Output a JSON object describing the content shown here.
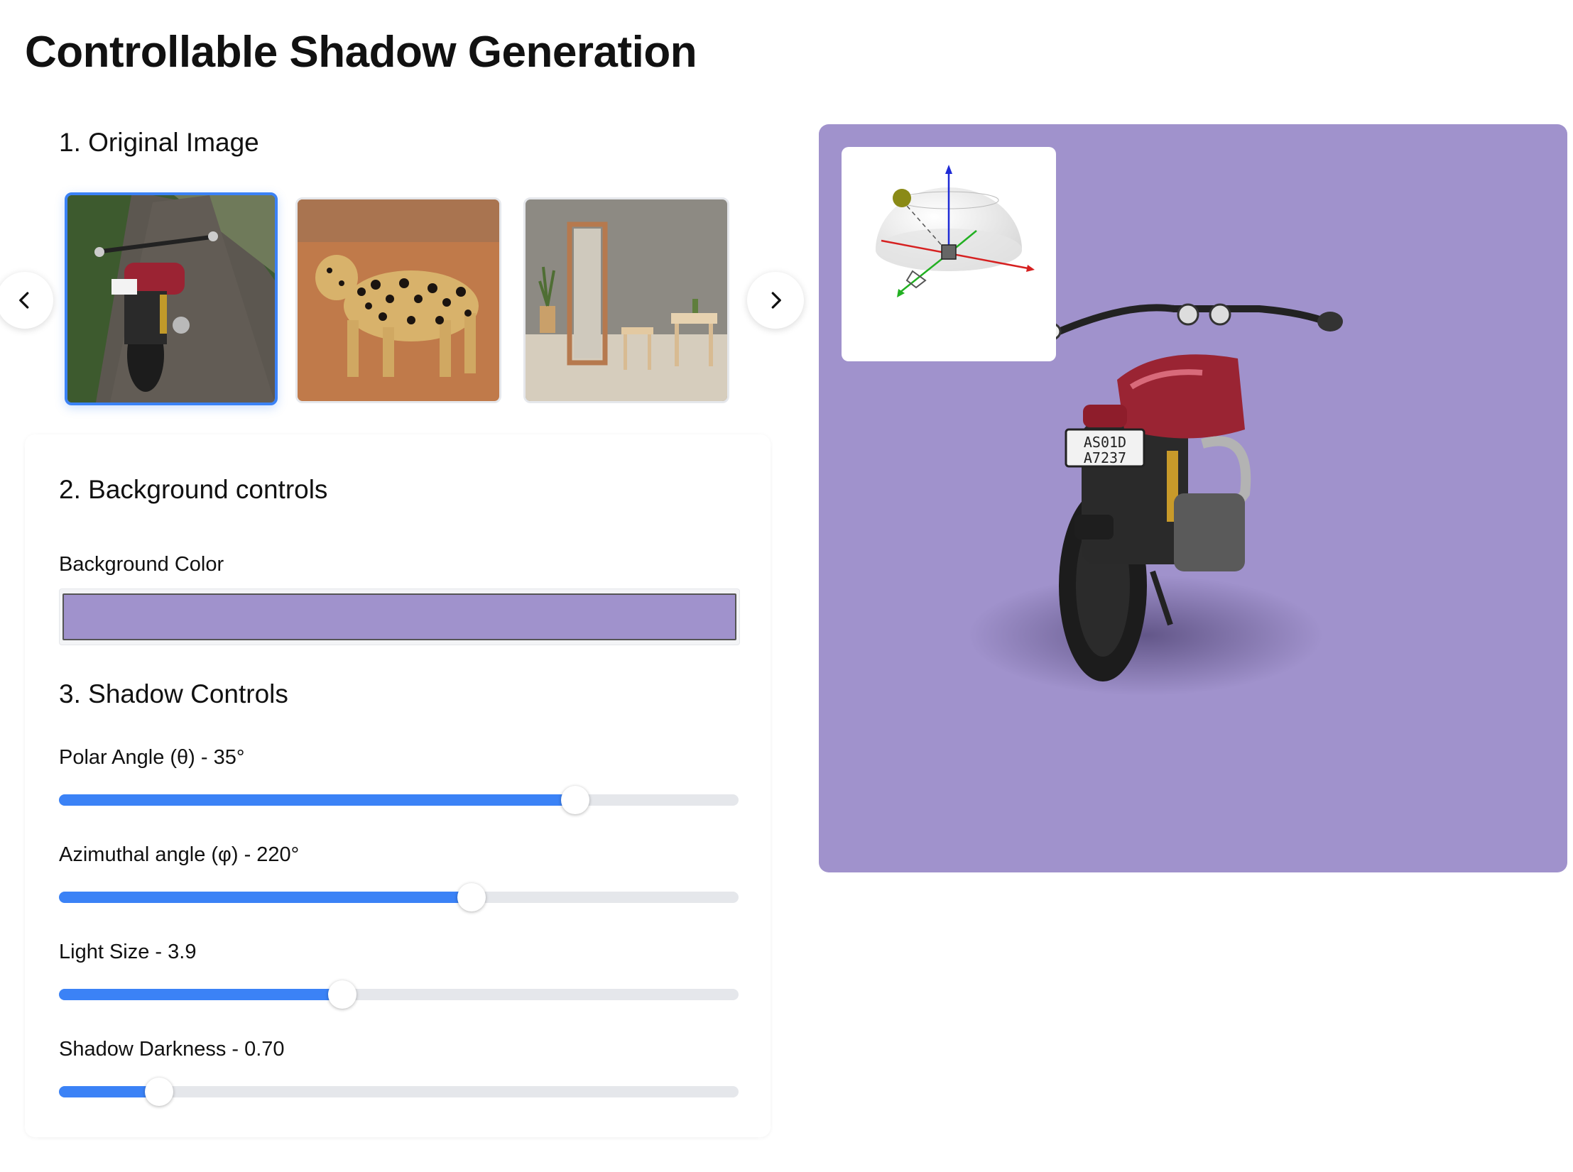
{
  "title": "Controllable Shadow Generation",
  "sections": {
    "original": "1. Original Image",
    "background": "2. Background controls",
    "shadow": "3. Shadow Controls"
  },
  "carousel": {
    "prev_icon": "chevron-left-icon",
    "next_icon": "chevron-right-icon",
    "thumbnails": [
      {
        "name": "motorcycle",
        "selected": true
      },
      {
        "name": "leopard",
        "selected": false
      },
      {
        "name": "room-interior",
        "selected": false
      }
    ]
  },
  "background": {
    "label": "Background Color",
    "color": "#a092cc"
  },
  "sliders": [
    {
      "label": "Polar Angle (θ) - 35°",
      "fraction": 0.76
    },
    {
      "label": "Azimuthal angle (φ) - 220°",
      "fraction": 0.607
    },
    {
      "label": "Light Size - 3.9",
      "fraction": 0.417
    },
    {
      "label": "Shadow Darkness - 0.70",
      "fraction": 0.147
    }
  ],
  "colors": {
    "accent": "#3b82f6",
    "track": "#e5e7eb",
    "output_background": "#a092cc"
  }
}
